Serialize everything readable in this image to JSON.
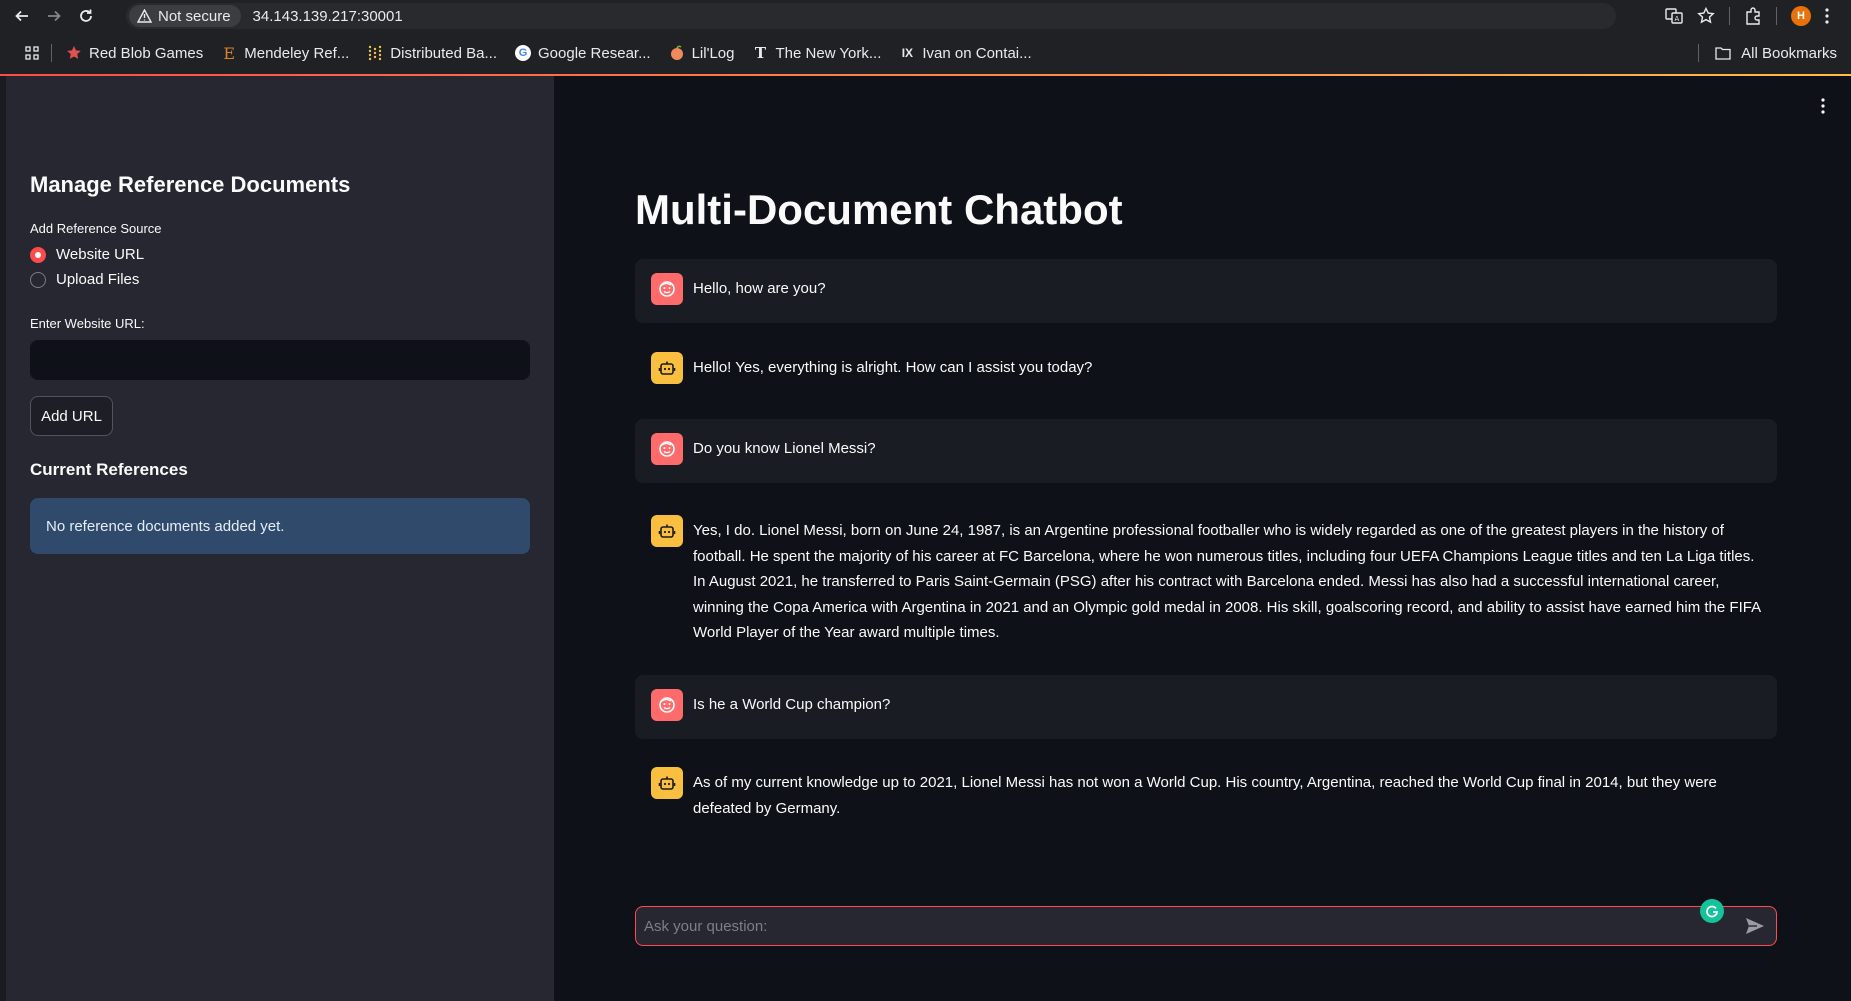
{
  "browser": {
    "security_label": "Not secure",
    "url": "34.143.139.217:30001",
    "profile_initial": "H",
    "bookmarks": [
      {
        "label": "Red Blob Games"
      },
      {
        "label": "Mendeley Ref...",
        "icon_text": "E"
      },
      {
        "label": "Distributed Ba..."
      },
      {
        "label": "Google Resear...",
        "icon_text": "G"
      },
      {
        "label": "Lil'Log"
      },
      {
        "label": "The New York...",
        "icon_text": "T"
      },
      {
        "label": "Ivan on Contai...",
        "icon_text": "IX"
      }
    ],
    "all_bookmarks_label": "All Bookmarks"
  },
  "colors": {
    "primary": "#ff4b4b",
    "user_avatar": "#ff6b6b",
    "bot_avatar": "#fbbf40",
    "info_box": "#2f4a6b"
  },
  "sidebar": {
    "title": "Manage Reference Documents",
    "source_label": "Add Reference Source",
    "options": [
      {
        "label": "Website URL",
        "selected": true
      },
      {
        "label": "Upload Files",
        "selected": false
      }
    ],
    "url_label": "Enter Website URL:",
    "url_value": "",
    "add_button": "Add URL",
    "references_title": "Current References",
    "references_empty": "No reference documents added yet."
  },
  "main": {
    "title": "Multi-Document Chatbot",
    "messages": [
      {
        "role": "user",
        "text": "Hello, how are you?"
      },
      {
        "role": "assistant",
        "text": "Hello! Yes, everything is alright. How can I assist you today?"
      },
      {
        "role": "user",
        "text": "Do you know Lionel Messi?"
      },
      {
        "role": "assistant",
        "text": "Yes, I do. Lionel Messi, born on June 24, 1987, is an Argentine professional footballer who is widely regarded as one of the greatest players in the history of football. He spent the majority of his career at FC Barcelona, where he won numerous titles, including four UEFA Champions League titles and ten La Liga titles. In August 2021, he transferred to Paris Saint-Germain (PSG) after his contract with Barcelona ended. Messi has also had a successful international career, winning the Copa America with Argentina in 2021 and an Olympic gold medal in 2008. His skill, goalscoring record, and ability to assist have earned him the FIFA World Player of the Year award multiple times."
      },
      {
        "role": "user",
        "text": "Is he a World Cup champion?"
      },
      {
        "role": "assistant",
        "text": "As of my current knowledge up to 2021, Lionel Messi has not won a World Cup. His country, Argentina, reached the World Cup final in 2014, but they were defeated by Germany."
      }
    ],
    "chat_placeholder": "Ask your question:"
  }
}
